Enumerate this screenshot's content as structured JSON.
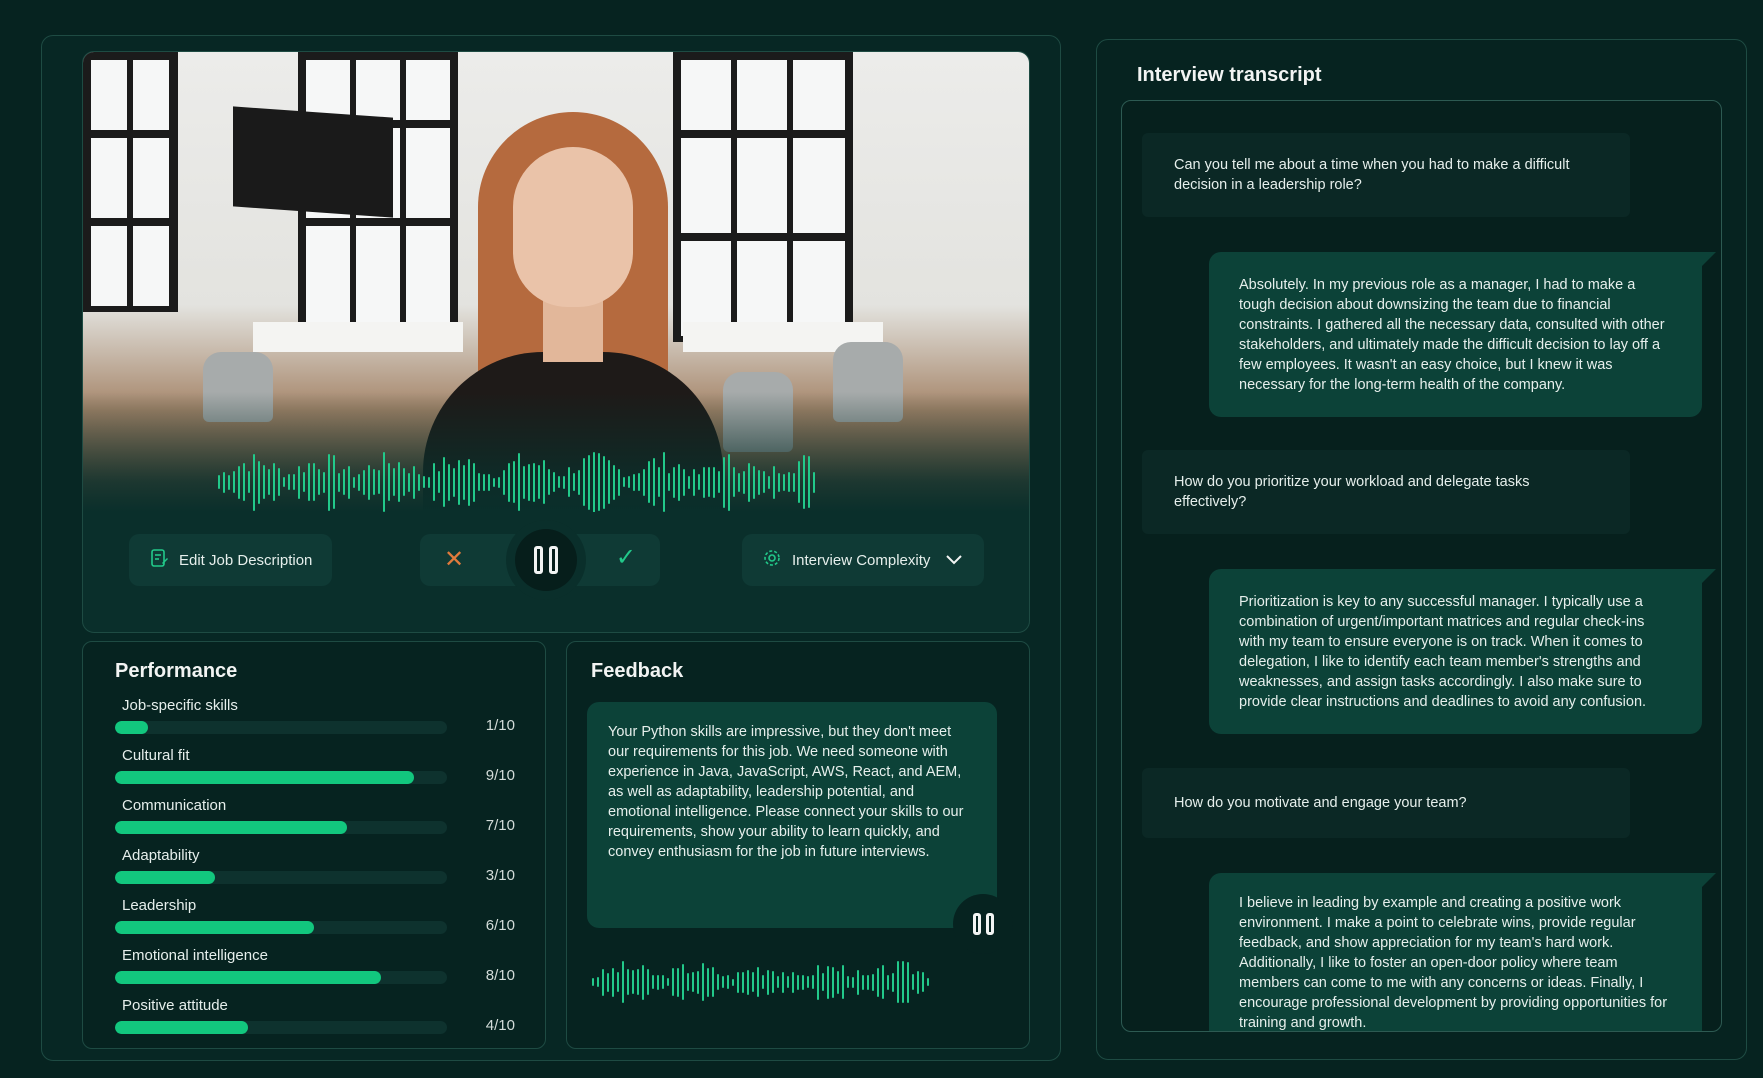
{
  "controls": {
    "edit_job_description": "Edit Job Description",
    "interview_complexity": "Interview Complexity"
  },
  "performance": {
    "title": "Performance",
    "items": [
      {
        "label": "Job-specific skills",
        "score": "1/10",
        "value": 1
      },
      {
        "label": "Cultural fit",
        "score": "9/10",
        "value": 9
      },
      {
        "label": "Communication",
        "score": "7/10",
        "value": 7
      },
      {
        "label": "Adaptability",
        "score": "3/10",
        "value": 3
      },
      {
        "label": "Leadership",
        "score": "6/10",
        "value": 6
      },
      {
        "label": "Emotional intelligence",
        "score": "8/10",
        "value": 8
      },
      {
        "label": "Positive attitude",
        "score": "4/10",
        "value": 4
      }
    ]
  },
  "feedback": {
    "title": "Feedback",
    "text": "Your Python skills are impressive, but they don't meet our requirements for this job. We need someone with experience in Java, JavaScript, AWS, React, and AEM, as well as adaptability, leadership potential, and emotional intelligence. Please connect your skills to our requirements, show your ability to learn quickly, and convey enthusiasm for the job in future interviews."
  },
  "transcript": {
    "title": "Interview transcript",
    "messages": [
      {
        "role": "interviewer",
        "text": "Can you tell me about a time when you had to make a difficult decision in a leadership role?"
      },
      {
        "role": "candidate",
        "text": "Absolutely. In my previous role as a manager, I had to make a tough decision about downsizing the team due to financial constraints. I gathered all the necessary data, consulted with other stakeholders, and ultimately made the difficult decision to lay off a few employees. It wasn't an easy choice, but I knew it was necessary for the long-term health of the company."
      },
      {
        "role": "interviewer",
        "text": "How do you prioritize your workload and delegate tasks effectively?"
      },
      {
        "role": "candidate",
        "text": "Prioritization is key to any successful manager. I typically use a combination of urgent/important matrices and regular check-ins with my team to ensure everyone is on track. When it comes to delegation, I like to identify each team member's strengths and weaknesses, and assign tasks accordingly. I also make sure to provide clear instructions and deadlines to avoid any confusion."
      },
      {
        "role": "interviewer",
        "text": "How do you motivate and engage your team?"
      },
      {
        "role": "candidate",
        "text": "I believe in leading by example and creating a positive work environment. I make a point to celebrate wins, provide regular feedback, and show appreciation for my team's hard work. Additionally, I like to foster an open-door policy where team members can come to me with any concerns or ideas. Finally, I encourage professional development by providing opportunities for training and growth."
      }
    ]
  },
  "colors": {
    "background": "#062320",
    "accent": "#12c77e",
    "bubble": "#0c4238",
    "reject": "#e07a3c"
  }
}
